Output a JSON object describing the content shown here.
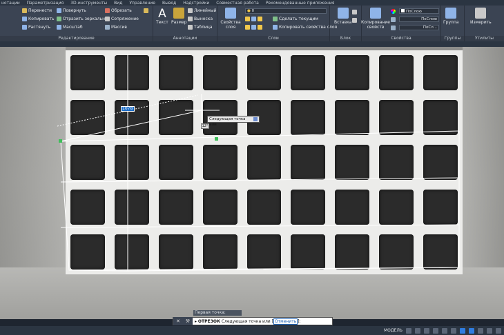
{
  "menubar": {
    "items": [
      "нотации",
      "Параметризация",
      "3D-инструменты",
      "Вид",
      "Управление",
      "Вывод",
      "Надстройки",
      "Совместная работа",
      "Рекомендованные приложения"
    ]
  },
  "ribbon": {
    "edit": {
      "title": "Редактирование",
      "items": [
        "Перенести",
        "Повернуть",
        "Обрезать",
        "Копировать",
        "Отразить зеркально",
        "Сопряжение",
        "Растянуть",
        "Масштаб",
        "Массив"
      ]
    },
    "annotations": {
      "title": "Аннотации",
      "text_btn": "Текст",
      "dim_btn": "Размер",
      "items": [
        "Линейный",
        "Выноска",
        "Таблица"
      ]
    },
    "layers": {
      "title": "Слои",
      "props_btn": "Свойства слоя",
      "layer_value": "0",
      "items": [
        "Сделать текущим",
        "Копировать свойства слоя"
      ]
    },
    "block": {
      "title": "Блок",
      "insert_btn": "Вставка"
    },
    "properties": {
      "title": "Свойства",
      "copy_btn": "Копирование свойств",
      "color_value": "ПоСлою",
      "linetype_value": "ПоСлою",
      "lineweight_value": "ПоСл..."
    },
    "groups": {
      "title": "Группы",
      "group_btn": "Группа"
    },
    "utilities": {
      "title": "Утилиты",
      "measure_btn": "Измерить"
    }
  },
  "canvas": {
    "dim_input_value": "1078",
    "tooltip_text": "Следующая точка или",
    "angle_value": "12°"
  },
  "command": {
    "history_line": "Первая точка:",
    "keyword": "ОТРЕЗОК",
    "prompt": "Следующая точка или",
    "option": "Отменить",
    "suffix": "]:"
  },
  "status": {
    "model_label": "МОДЕЛЬ"
  },
  "colors": {
    "ribbon_bg": "#3b4453",
    "accent": "#2f7de1",
    "cad_line": "#ffffff"
  }
}
